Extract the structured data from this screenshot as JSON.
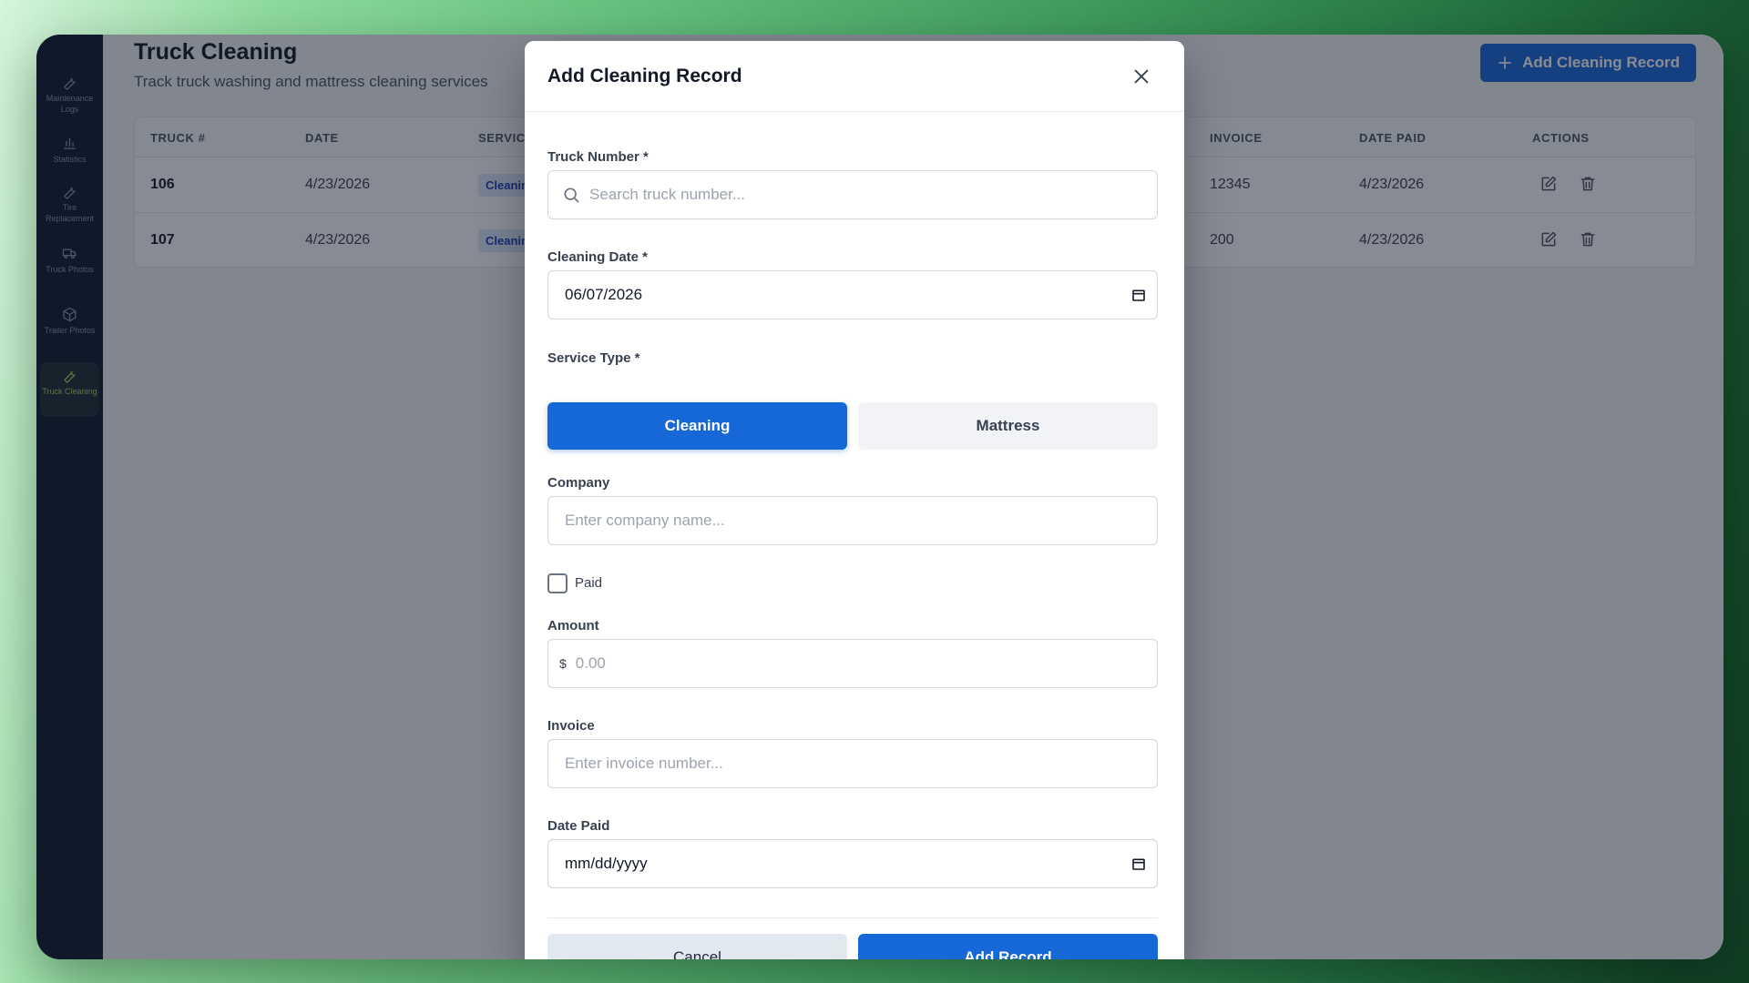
{
  "sidebar": {
    "items": [
      {
        "label": "Maintenance Logs",
        "icon": "wrench-icon"
      },
      {
        "label": "Statistics",
        "icon": "bar-chart-icon"
      },
      {
        "label": "Tire Replacement",
        "icon": "wrench-icon"
      },
      {
        "label": "Truck Photos",
        "icon": "truck-icon"
      },
      {
        "label": "Trailer Photos",
        "icon": "box-icon"
      },
      {
        "label": "Truck Cleaning",
        "icon": "wrench-icon",
        "active": true
      }
    ]
  },
  "header": {
    "title": "Truck Cleaning",
    "subtitle": "Track truck washing and mattress cleaning services",
    "add_button_label": "Add Cleaning Record"
  },
  "table": {
    "columns": [
      "TRUCK #",
      "DATE",
      "SERVIC",
      "INVOICE",
      "DATE PAID",
      "ACTIONS"
    ],
    "rows": [
      {
        "truck": "106",
        "date": "4/23/2026",
        "service": "Cleanin",
        "invoice": "12345",
        "date_paid": "4/23/2026"
      },
      {
        "truck": "107",
        "date": "4/23/2026",
        "service": "Cleanin",
        "invoice": "200",
        "date_paid": "4/23/2026"
      }
    ]
  },
  "modal": {
    "title": "Add Cleaning Record",
    "truck_number": {
      "label": "Truck Number *",
      "placeholder": "Search truck number..."
    },
    "cleaning_date": {
      "label": "Cleaning Date *",
      "value": "06/07/2026"
    },
    "service_type": {
      "label": "Service Type *",
      "options": [
        "Cleaning",
        "Mattress"
      ],
      "selected": "Cleaning"
    },
    "company": {
      "label": "Company",
      "placeholder": "Enter company name..."
    },
    "paid": {
      "label": "Paid",
      "checked": false
    },
    "amount": {
      "label": "Amount",
      "prefix": "$",
      "placeholder": "0.00"
    },
    "invoice": {
      "label": "Invoice",
      "placeholder": "Enter invoice number..."
    },
    "date_paid": {
      "label": "Date Paid",
      "placeholder": "mm/dd/yyyy"
    },
    "cancel_label": "Cancel",
    "submit_label": "Add Record"
  },
  "colors": {
    "primary": "#1667d8",
    "sidebar_bg": "#0f1a2b",
    "active_nav": "#a8d36a",
    "badge_bg": "#dbeafe"
  }
}
